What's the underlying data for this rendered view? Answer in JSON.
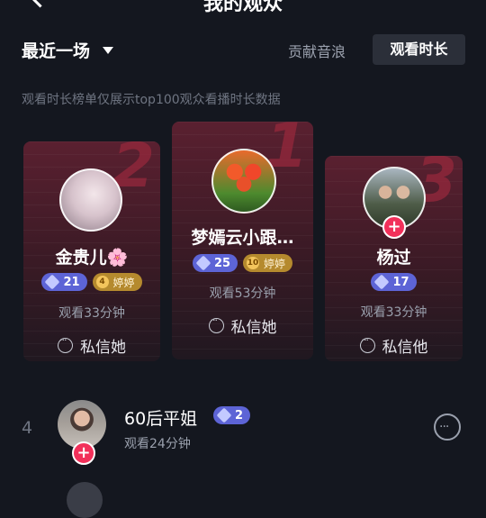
{
  "header": {
    "title": "我的观众"
  },
  "filter": {
    "label": "最近一场"
  },
  "tabs": {
    "contribution": "贡献音浪",
    "watch_time": "观看时长"
  },
  "notice": "观看时长榜单仅展示top100观众看播时长数据",
  "top3": [
    {
      "rank": "1",
      "name": "梦嫣云小跟…",
      "level": "25",
      "fan_club": "婷婷",
      "fan_level": "10",
      "watch": "观看53分钟",
      "dm": "私信她"
    },
    {
      "rank": "2",
      "name": "金贵儿🌸",
      "level": "21",
      "fan_club": "婷婷",
      "fan_level": "4",
      "watch": "观看33分钟",
      "dm": "私信她"
    },
    {
      "rank": "3",
      "name": "杨过",
      "level": "17",
      "watch": "观看33分钟",
      "dm": "私信他"
    }
  ],
  "list": [
    {
      "rank": "4",
      "name": "60后平姐",
      "level": "2",
      "watch": "观看24分钟"
    }
  ]
}
